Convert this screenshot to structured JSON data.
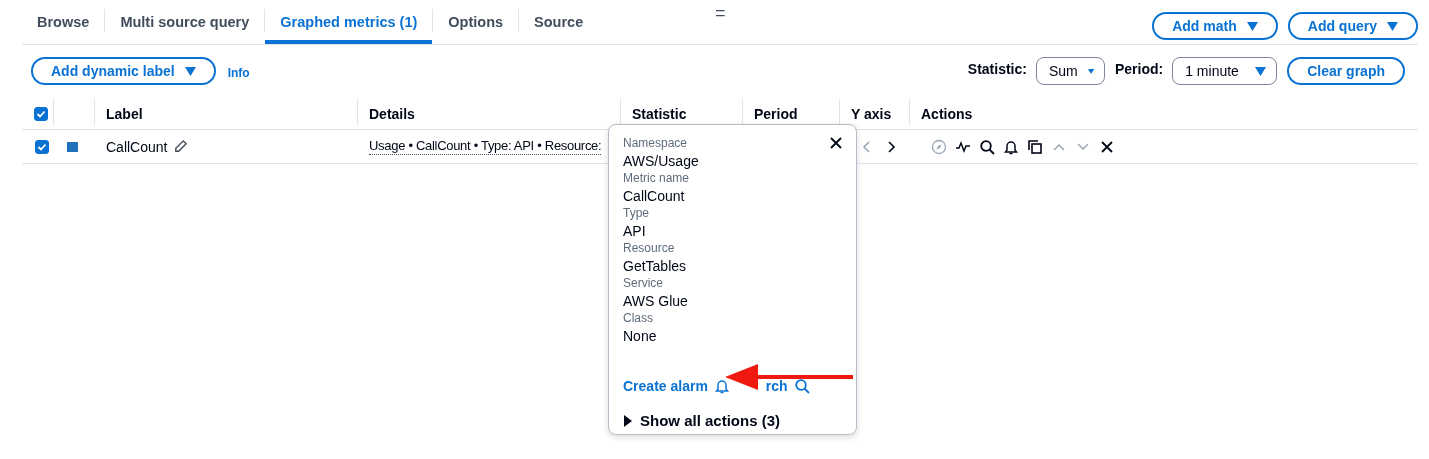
{
  "tabs": [
    {
      "label": "Browse",
      "selected": false
    },
    {
      "label": "Multi source query",
      "selected": false
    },
    {
      "label": "Graphed metrics (1)",
      "selected": true
    },
    {
      "label": "Options",
      "selected": false
    },
    {
      "label": "Source",
      "selected": false
    }
  ],
  "drag_handle": "=",
  "header_buttons": [
    {
      "label": "Add math"
    },
    {
      "label": "Add query"
    }
  ],
  "toolbar": {
    "dynamic_label": "Add dynamic label",
    "info": "Info",
    "statistic_label": "Statistic:",
    "statistic_value": "Sum",
    "period_label": "Period:",
    "period_value": "1 minute",
    "clear": "Clear graph"
  },
  "table": {
    "all_checked": true,
    "columns": [
      "Label",
      "Details",
      "Statistic",
      "Period",
      "Y axis",
      "Actions"
    ],
    "rows": [
      {
        "checked": true,
        "color": "#1f70b8",
        "label": "CallCount",
        "details": "Usage • CallCount • Type: API • Resource:",
        "y_axis": [
          {
            "kind": "left",
            "disabled": true
          },
          {
            "kind": "right",
            "disabled": false
          }
        ],
        "actions": [
          {
            "kind": "compass",
            "disabled": true
          },
          {
            "kind": "pulse",
            "disabled": false
          },
          {
            "kind": "search",
            "disabled": false
          },
          {
            "kind": "bell",
            "disabled": false
          },
          {
            "kind": "copy",
            "disabled": false
          },
          {
            "kind": "up",
            "disabled": true
          },
          {
            "kind": "down",
            "disabled": true
          },
          {
            "kind": "close",
            "disabled": false
          }
        ]
      }
    ]
  },
  "popover": {
    "fields": [
      {
        "label": "Namespace",
        "value": "AWS/Usage"
      },
      {
        "label": "Metric name",
        "value": "CallCount"
      },
      {
        "label": "Type",
        "value": "API"
      },
      {
        "label": "Resource",
        "value": "GetTables"
      },
      {
        "label": "Service",
        "value": "AWS Glue"
      },
      {
        "label": "Class",
        "value": "None"
      }
    ],
    "links": [
      {
        "kind": "bell",
        "label": "Create alarm"
      },
      {
        "kind": "search",
        "label": "rch"
      }
    ],
    "expander": {
      "label": "Show all actions (3)",
      "expanded": false
    }
  }
}
